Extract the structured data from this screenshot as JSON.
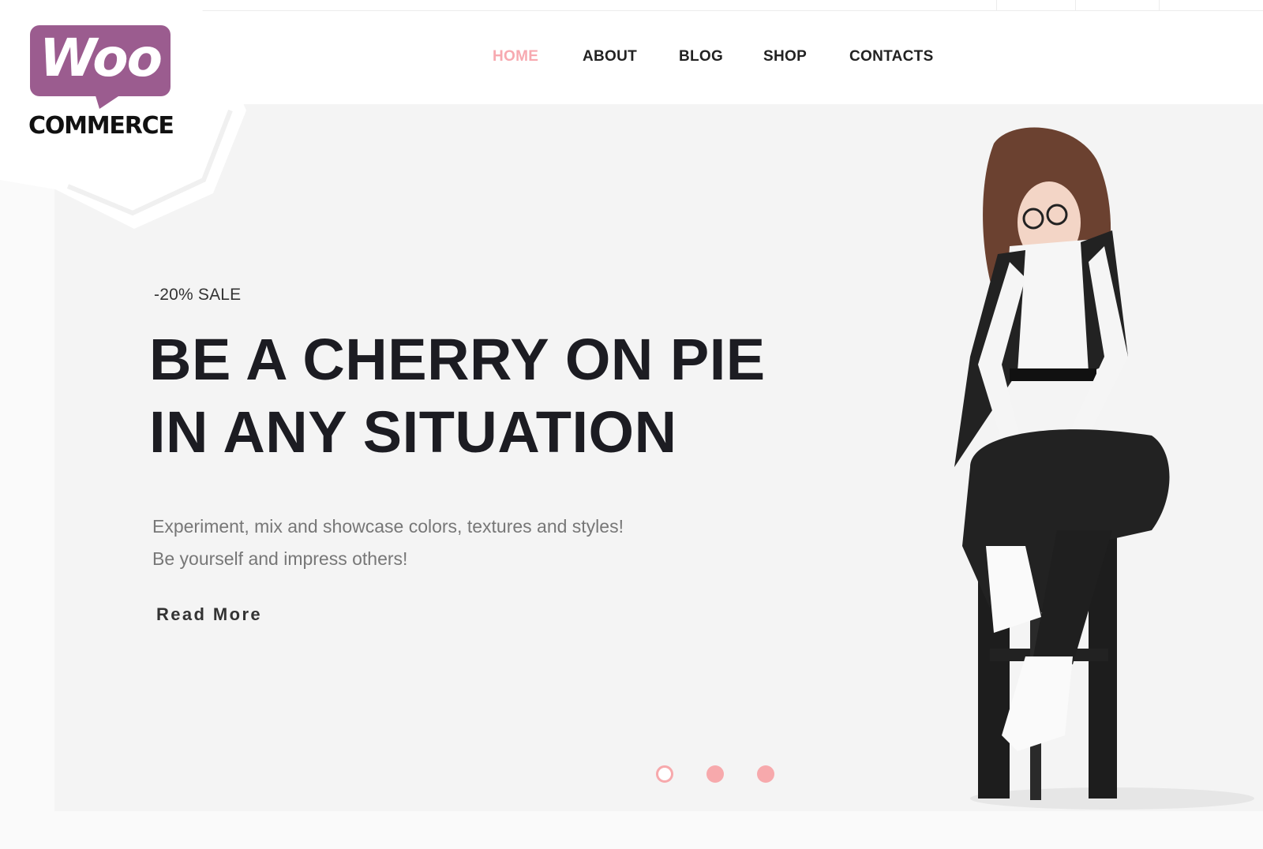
{
  "logo": {
    "brand_top": "Woo",
    "brand_bottom": "COMMERCE",
    "brand_color": "#9b5c8f"
  },
  "nav": {
    "items": [
      {
        "label": "HOME",
        "active": true
      },
      {
        "label": "ABOUT",
        "active": false
      },
      {
        "label": "BLOG",
        "active": false
      },
      {
        "label": "SHOP",
        "active": false
      },
      {
        "label": "CONTACTS",
        "active": false
      }
    ],
    "active_color": "#f7a9b0"
  },
  "hero": {
    "sale_label": "-20% SALE",
    "headline_line1": "BE A CHERRY ON PIE",
    "headline_line2": "IN ANY SITUATION",
    "subtext_line1": "Experiment, mix and showcase colors, textures and styles!",
    "subtext_line2": "Be yourself and impress others!",
    "cta_label": "Read More",
    "slider_dots": 3,
    "active_slide": 1,
    "accent_color": "#f7a9ac"
  }
}
